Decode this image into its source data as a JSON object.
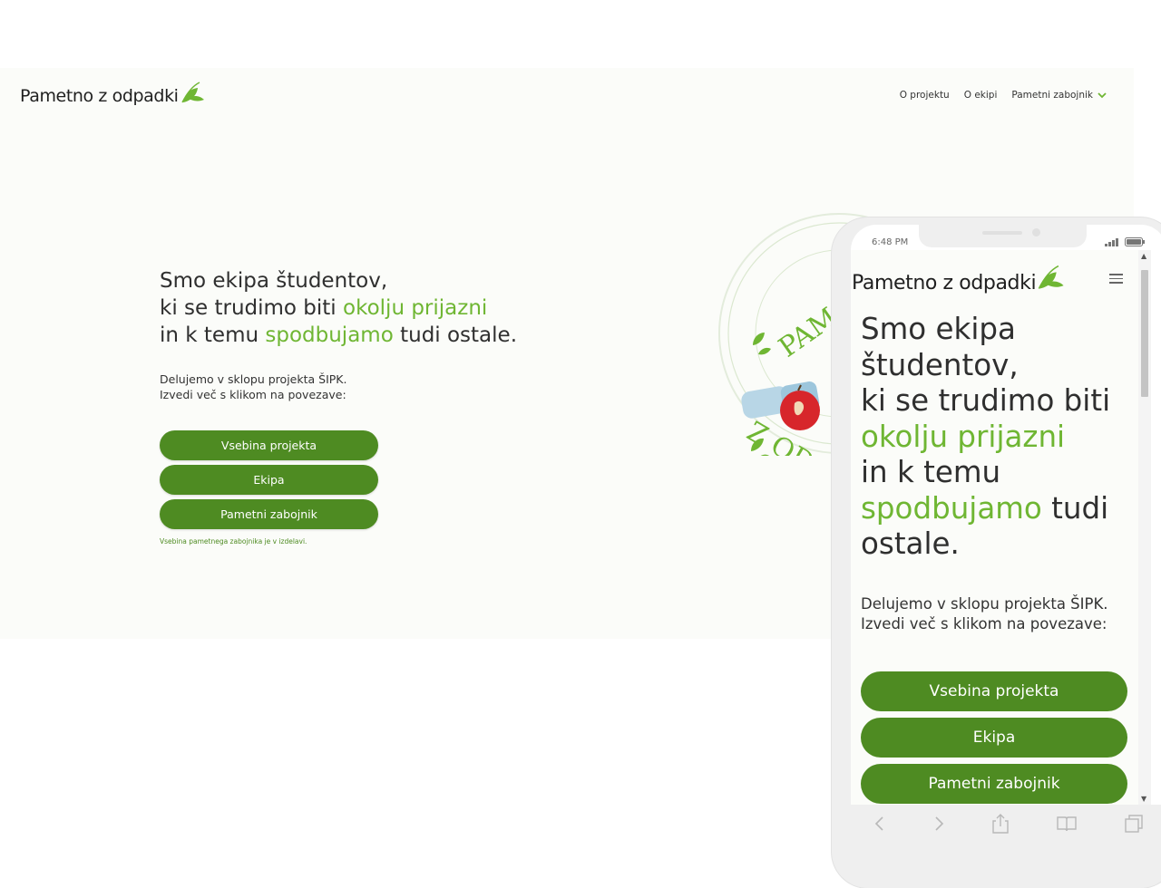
{
  "brand": {
    "name": "Pametno z odpadki",
    "accent": "#6fb633",
    "button_color": "#4e8b22"
  },
  "nav": {
    "items": [
      "O projektu",
      "O ekipi"
    ],
    "dropdown": "Pametni zabojnik"
  },
  "hero": {
    "line1": "Smo ekipa študentov,",
    "line2_pre": "ki se trudimo biti ",
    "line2_green": "okolju prijazni",
    "line3_pre": "in k temu ",
    "line3_green": "spodbujamo",
    "line3_post": " tudi ostale."
  },
  "intro": {
    "line1": "Delujemo v sklopu projekta ŠIPK.",
    "line2": "Izvedi več s klikom na povezave:"
  },
  "buttons": [
    "Vsebina projekta",
    "Ekipa",
    "Pametni zabojnik"
  ],
  "note": "Vsebina pametnega zabojnika je v izdelavi.",
  "stamp": {
    "text_top": "PAM",
    "text_bottom": "Z OD"
  },
  "mobile": {
    "time": "6:48 PM",
    "hero_lines": [
      "Smo ekipa",
      "študentov,",
      "ki se trudimo biti"
    ],
    "green1": "okolju prijazni",
    "line5": "in k temu",
    "green2": "spodbujamo",
    "line6_post": " tudi",
    "line7": "ostale.",
    "toolbar_icons": [
      "back-icon",
      "forward-icon",
      "share-icon",
      "bookmarks-icon",
      "tabs-icon"
    ]
  }
}
